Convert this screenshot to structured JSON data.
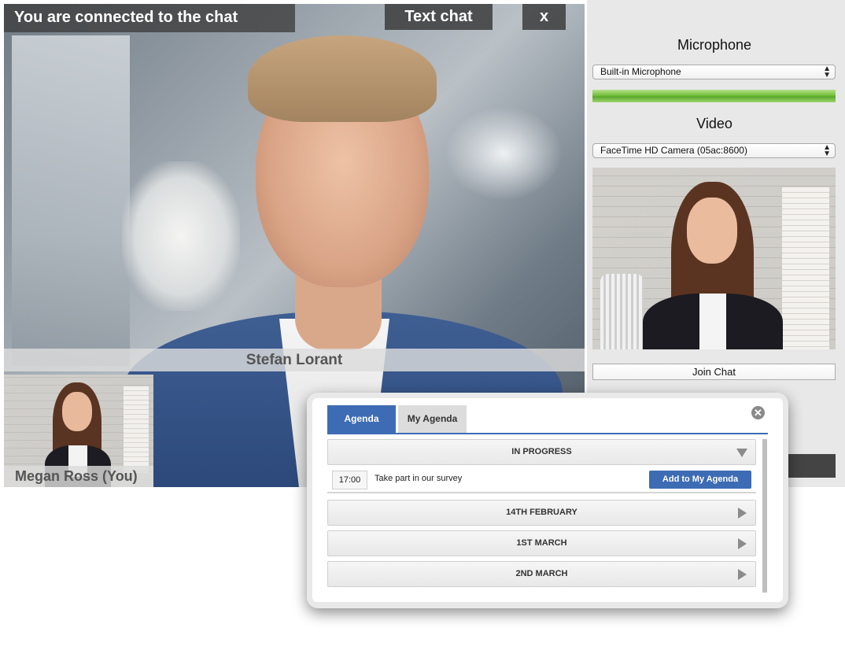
{
  "video": {
    "status_text": "You are connected to the chat",
    "text_chat_label": "Text chat",
    "close_label": "x",
    "remote_name": "Stefan Lorant",
    "self_name": "Megan Ross (You)"
  },
  "settings": {
    "microphone_heading": "Microphone",
    "microphone_selected": "Built-in Microphone",
    "mic_level": 1.0,
    "video_heading": "Video",
    "camera_selected": "FaceTime HD Camera (05ac:8600)",
    "join_label": "Join Chat"
  },
  "agenda": {
    "tabs": [
      {
        "label": "Agenda",
        "active": true
      },
      {
        "label": "My Agenda",
        "active": false
      }
    ],
    "sections": [
      {
        "label": "IN PROGRESS",
        "expanded": true
      },
      {
        "label": "14TH FEBRUARY",
        "expanded": false
      },
      {
        "label": "1ST MARCH",
        "expanded": false
      },
      {
        "label": "2ND MARCH",
        "expanded": false
      }
    ],
    "items": [
      {
        "time": "17:00",
        "title": "Take part in our survey",
        "action_label": "Add to My Agenda"
      }
    ]
  },
  "colors": {
    "accent": "#3d6cb5",
    "meter": "#73c13c"
  }
}
